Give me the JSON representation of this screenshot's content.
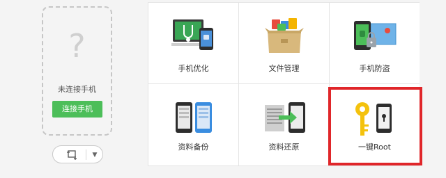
{
  "phone": {
    "placeholder_glyph": "?",
    "status": "未连接手机",
    "connect_label": "连接手机"
  },
  "tools": {
    "screenshot_icon": "screenshot-icon",
    "dropdown_icon": "chevron-down-icon"
  },
  "tiles": [
    {
      "label": "手机优化",
      "icon": "stethoscope-laptop-icon"
    },
    {
      "label": "文件管理",
      "icon": "file-box-icon"
    },
    {
      "label": "手机防盗",
      "icon": "phone-lock-map-icon"
    },
    {
      "label": "资料备份",
      "icon": "phone-backup-icon"
    },
    {
      "label": "资料还原",
      "icon": "document-restore-icon"
    },
    {
      "label": "一键Root",
      "icon": "key-phone-icon"
    }
  ],
  "colors": {
    "accent_green": "#4cbe59",
    "highlight_red": "#e0262a"
  }
}
